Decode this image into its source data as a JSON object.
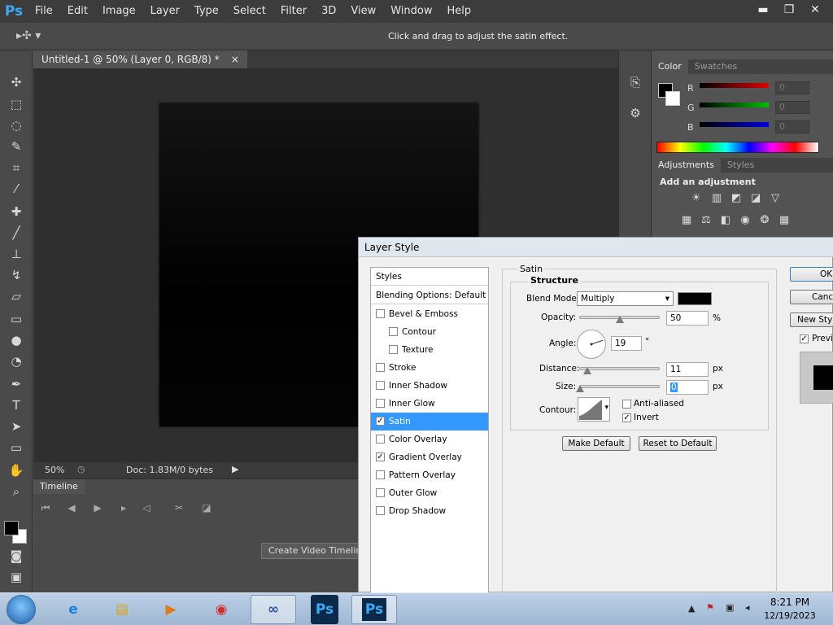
{
  "app": {
    "logo": "Ps"
  },
  "menu": [
    "File",
    "Edit",
    "Image",
    "Layer",
    "Type",
    "Select",
    "Filter",
    "3D",
    "View",
    "Window",
    "Help"
  ],
  "window_controls": {
    "minimize": "▬",
    "restore": "❐",
    "close": "✕"
  },
  "options_bar": {
    "hint": "Click and drag to adjust the satin effect."
  },
  "document": {
    "tab_title": "Untitled-1 @ 50% (Layer 0, RGB/8) *",
    "tab_close": "×",
    "zoom": "50%",
    "doc_info": "Doc: 1.83M/0 bytes"
  },
  "timeline": {
    "tab": "Timeline",
    "create_button": "Create Video Timeline"
  },
  "color_panel": {
    "tabs": [
      "Color",
      "Swatches"
    ],
    "channels": [
      {
        "label": "R",
        "value": "0",
        "color": "#e00000"
      },
      {
        "label": "G",
        "value": "0",
        "color": "#00c000"
      },
      {
        "label": "B",
        "value": "0",
        "color": "#0000e0"
      }
    ]
  },
  "adjustments_panel": {
    "tabs": [
      "Adjustments",
      "Styles"
    ],
    "title": "Add an adjustment"
  },
  "dialog": {
    "title": "Layer Style",
    "styles_header": "Styles",
    "blending_options": "Blending Options: Default",
    "items": [
      {
        "label": "Bevel & Emboss",
        "checked": false,
        "indent": false
      },
      {
        "label": "Contour",
        "checked": false,
        "indent": true
      },
      {
        "label": "Texture",
        "checked": false,
        "indent": true
      },
      {
        "label": "Stroke",
        "checked": false,
        "indent": false
      },
      {
        "label": "Inner Shadow",
        "checked": false,
        "indent": false
      },
      {
        "label": "Inner Glow",
        "checked": false,
        "indent": false
      },
      {
        "label": "Satin",
        "checked": true,
        "indent": false,
        "selected": true
      },
      {
        "label": "Color Overlay",
        "checked": false,
        "indent": false
      },
      {
        "label": "Gradient Overlay",
        "checked": true,
        "indent": false
      },
      {
        "label": "Pattern Overlay",
        "checked": false,
        "indent": false
      },
      {
        "label": "Outer Glow",
        "checked": false,
        "indent": false
      },
      {
        "label": "Drop Shadow",
        "checked": false,
        "indent": false
      }
    ],
    "satin": {
      "group_title": "Satin",
      "structure_title": "Structure",
      "blend_mode_label": "Blend Mode:",
      "blend_mode_value": "Multiply",
      "blend_color": "#000000",
      "opacity_label": "Opacity:",
      "opacity_value": "50",
      "opacity_unit": "%",
      "opacity_fraction": 0.5,
      "angle_label": "Angle:",
      "angle_value": "19",
      "angle_unit": "°",
      "distance_label": "Distance:",
      "distance_value": "11",
      "distance_unit": "px",
      "size_label": "Size:",
      "size_value": "0",
      "size_unit": "px",
      "contour_label": "Contour:",
      "anti_aliased_label": "Anti-aliased",
      "anti_aliased_checked": false,
      "invert_label": "Invert",
      "invert_checked": true,
      "make_default": "Make Default",
      "reset_default": "Reset to Default"
    },
    "buttons": {
      "ok": "OK",
      "cancel": "Canc",
      "new_style": "New Sty"
    },
    "preview_label": "Previ",
    "preview_checked": true
  },
  "taskbar": {
    "time": "8:21 PM",
    "date": "12/19/2023"
  }
}
